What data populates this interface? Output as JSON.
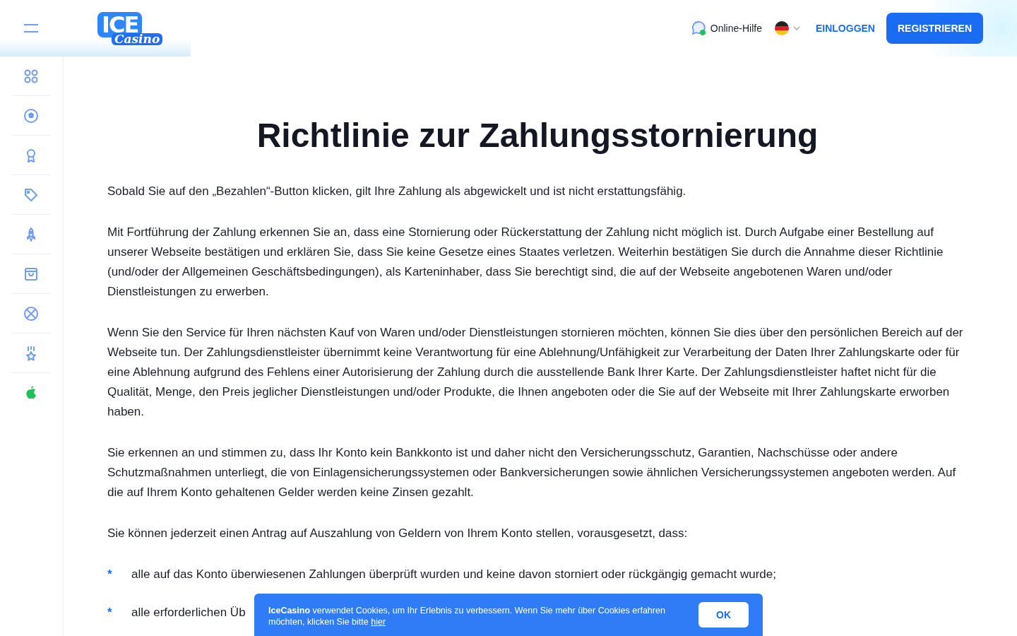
{
  "header": {
    "logo": {
      "top": "ICE",
      "script": "Casino"
    },
    "help_label": "Online-Hilfe",
    "login": "EINLOGGEN",
    "register": "REGISTRIEREN"
  },
  "content": {
    "title": "Richtlinie zur Zahlungsstornierung",
    "paragraphs": [
      "Sobald Sie auf den „Bezahlen“-Button klicken, gilt Ihre Zahlung als abgewickelt und ist nicht erstattungsfähig.",
      "Mit Fortführung der Zahlung erkennen Sie an, dass eine Stornierung oder Rückerstattung der Zahlung nicht möglich ist. Durch Aufgabe einer Bestellung auf unserer Webseite bestätigen und erklären Sie, dass Sie keine Gesetze eines Staates verletzen. Weiterhin bestätigen Sie durch die Annahme dieser Richtlinie (und/oder der Allgemeinen Geschäftsbedingungen), als Karteninhaber, dass Sie berechtigt sind, die auf der Webseite angebotenen Waren und/oder Dienstleistungen zu erwerben.",
      "Wenn Sie den Service für Ihren nächsten Kauf von Waren und/oder Dienstleistungen stornieren möchten, können Sie dies über den persönlichen Bereich auf der Webseite tun. Der Zahlungsdienstleister übernimmt keine Verantwortung für eine Ablehnung/Unfähigkeit zur Verarbeitung der Daten Ihrer Zahlungskarte oder für eine Ablehnung aufgrund des Fehlens einer Autorisierung der Zahlung durch die ausstellende Bank Ihrer Karte. Der Zahlungsdienstleister haftet nicht für die Qualität, Menge, den Preis jeglicher Dienstleistungen und/oder Produkte, die Ihnen angeboten oder die Sie auf der Webseite mit Ihrer Zahlungskarte erworben haben.",
      "Sie erkennen an und stimmen zu, dass Ihr Konto kein Bankkonto ist und daher nicht den Versicherungsschutz, Garantien, Nachschüsse oder andere Schutzmaßnahmen unterliegt, die von Einlagensicherungssystemen oder Bankversicherungen sowie ähnlichen Versicherungssystemen angeboten werden. Auf die auf Ihrem Konto gehaltenen Gelder werden keine Zinsen gezahlt.",
      "Sie können jederzeit einen Antrag auf Auszahlung von Geldern von Ihrem Konto stellen, vorausgesetzt, dass:"
    ],
    "bullets": [
      {
        "marker": "*",
        "text": "alle auf das Konto überwiesenen Zahlungen überprüft wurden und keine davon storniert oder rückgängig gemacht wurde;"
      },
      {
        "marker": "*",
        "text": "alle erforderlichen Üb"
      }
    ]
  },
  "cookie_banner": {
    "text": "**IceCasino** verwendet Cookies, um Ihr Erlebnis zu verbessern. Wenn Sie mehr über Cookies erfahren möchten, klicken Sie bitte ",
    "link": "hier",
    "button": "OK"
  }
}
